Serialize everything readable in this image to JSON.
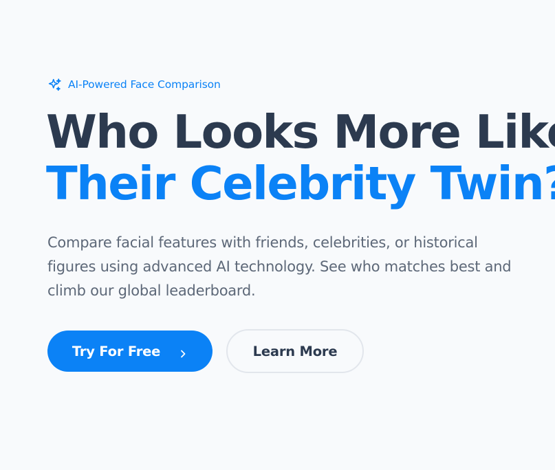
{
  "badge": {
    "icon": "sparkles-icon",
    "label": "AI-Powered Face Comparison"
  },
  "headline": {
    "line1": "Who Looks More Like",
    "line2": "Their Celebrity Twin?"
  },
  "subtitle": "Compare facial features with friends, celebrities, or historical figures using advanced AI technology. See who matches best and climb our global leaderboard.",
  "buttons": {
    "primary_label": "Try For Free",
    "primary_icon": "chevron-right-icon",
    "secondary_label": "Learn More"
  },
  "colors": {
    "accent": "#0b82f6",
    "heading": "#2c3a4f",
    "body_text": "#5d6878",
    "background": "#f8fafc"
  }
}
